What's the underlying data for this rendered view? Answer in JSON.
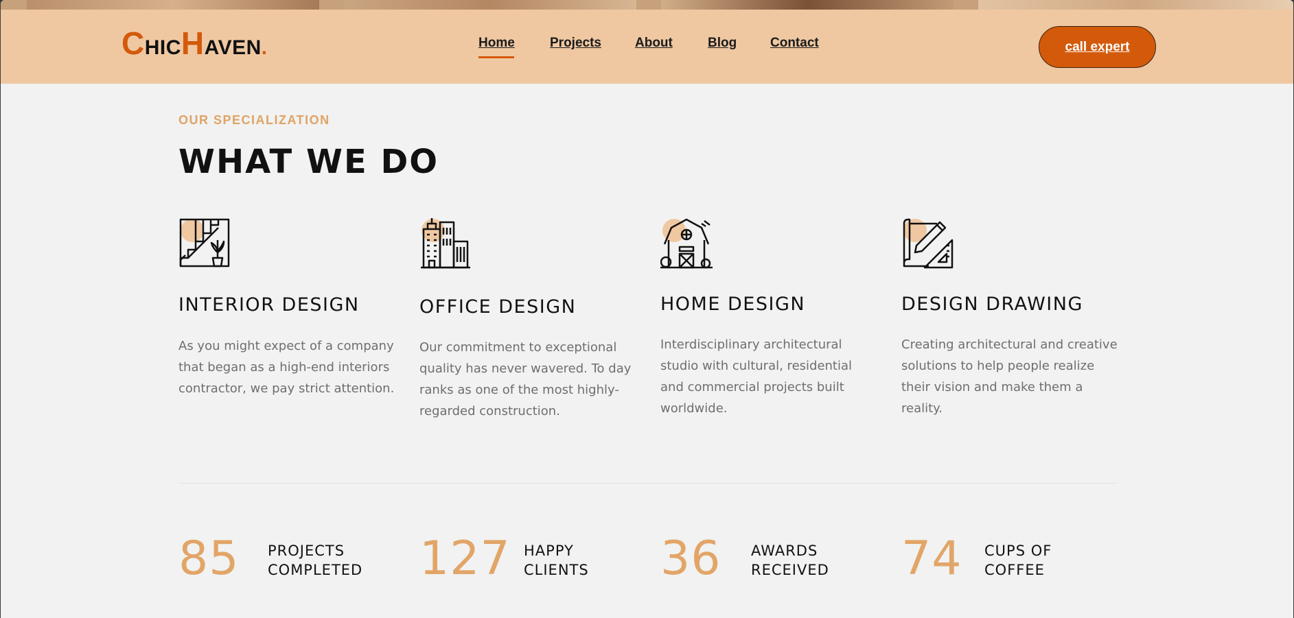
{
  "brand": {
    "first": "C",
    "first_rest": "HIC",
    "second": "H",
    "second_rest": "AVEN",
    "dot": "."
  },
  "nav": {
    "items": [
      {
        "label": "Home"
      },
      {
        "label": "Projects"
      },
      {
        "label": "About"
      },
      {
        "label": "Blog"
      },
      {
        "label": "Contact"
      }
    ],
    "active": "Home"
  },
  "cta": {
    "label": "call expert"
  },
  "section": {
    "kicker": "OUR SPECIALIZATION",
    "title": "WHAT WE DO"
  },
  "services": [
    {
      "icon": "staircase-plant-icon",
      "title": "INTERIOR DESIGN",
      "text": "As you might expect of a company that began as a high-end interiors contractor, we pay strict attention."
    },
    {
      "icon": "office-buildings-icon",
      "title": "OFFICE DESIGN",
      "text": "Our commitment to exceptional quality has never wavered. To day ranks as one of the most highly-regarded construction."
    },
    {
      "icon": "barn-house-icon",
      "title": "HOME DESIGN",
      "text": "Interdisciplinary architectural studio with cultural, residential and commercial projects built worldwide."
    },
    {
      "icon": "drafting-tools-icon",
      "title": "DESIGN DRAWING",
      "text": "Creating architectural and creative solutions to help people realize their vision and make them a reality."
    }
  ],
  "stats": [
    {
      "number": "85",
      "line1": "PROJECTS",
      "line2": "COMPLETED"
    },
    {
      "number": "127",
      "line1": "HAPPY",
      "line2": "CLIENTS"
    },
    {
      "number": "36",
      "line1": "AWARDS",
      "line2": "RECEIVED"
    },
    {
      "number": "74",
      "line1": "CUPS OF",
      "line2": "COFFEE"
    }
  ],
  "colors": {
    "accent": "#d35a0b",
    "header_bg": "#efc8a2",
    "kicker": "#e0a366",
    "page_bg": "#f1f2f1"
  }
}
